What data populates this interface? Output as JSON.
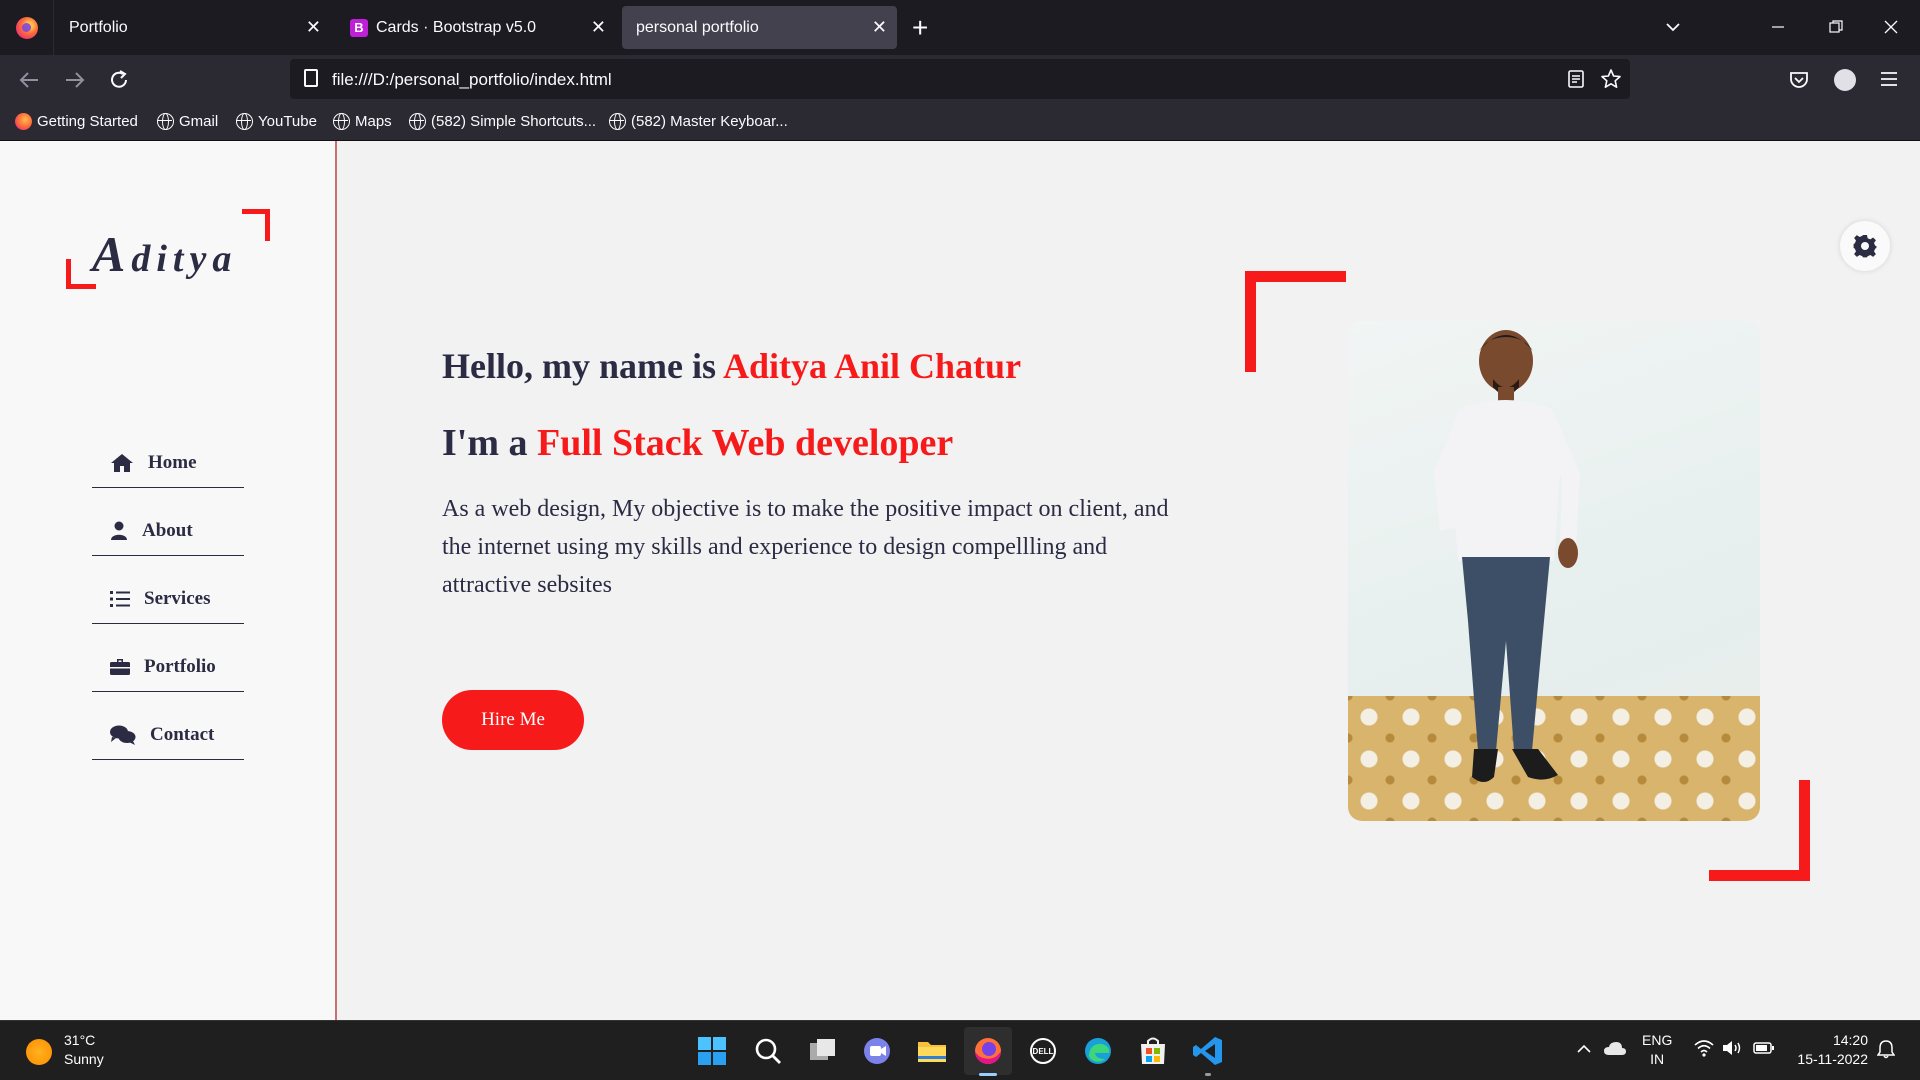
{
  "browser": {
    "tabs": [
      {
        "title": "Portfolio",
        "active": false
      },
      {
        "title": "Cards · Bootstrap v5.0",
        "active": false
      },
      {
        "title": "personal portfolio",
        "active": true
      }
    ],
    "url": "file:///D:/personal_portfolio/index.html",
    "bookmarks": [
      "Getting Started",
      "Gmail",
      "YouTube",
      "Maps",
      "(582) Simple Shortcuts...",
      "(582) Master Keyboar..."
    ]
  },
  "page": {
    "logo": {
      "initial": "A",
      "rest": "ditya"
    },
    "menu": [
      {
        "label": "Home",
        "icon": "home-icon"
      },
      {
        "label": "About",
        "icon": "user-icon"
      },
      {
        "label": "Services",
        "icon": "list-icon"
      },
      {
        "label": "Portfolio",
        "icon": "briefcase-icon"
      },
      {
        "label": "Contact",
        "icon": "comments-icon"
      }
    ],
    "hero": {
      "greeting_prefix": "Hello, my name is ",
      "name": "Aditya Anil Chatur",
      "role_prefix": "I'm a ",
      "role": "Full Stack Web developer",
      "description": "As a web design, My objective is to make the positive impact on client, and the internet using my skills and experience to design compellling and attractive sebsites",
      "cta": "Hire Me"
    },
    "colors": {
      "accent": "#f71a1a",
      "text": "#2b2b44",
      "background": "#f2f2f2"
    }
  },
  "taskbar": {
    "weather": {
      "temp": "31°C",
      "condition": "Sunny"
    },
    "language": {
      "lang": "ENG",
      "region": "IN"
    },
    "clock": {
      "time": "14:20",
      "date": "15-11-2022"
    }
  }
}
